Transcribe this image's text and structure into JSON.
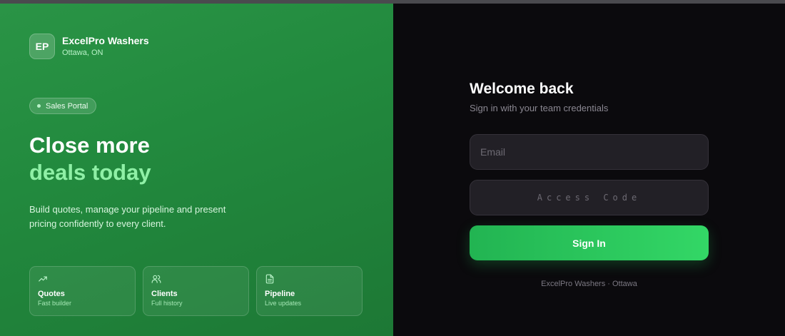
{
  "brand": {
    "logo_initials": "EP",
    "name": "ExcelPro Washers",
    "location": "Ottawa, ON"
  },
  "badge": {
    "label": "Sales Portal"
  },
  "hero": {
    "headline_line1": "Close more",
    "headline_line2": "deals today",
    "description": "Build quotes, manage your pipeline and present pricing confidently to every client."
  },
  "features": [
    {
      "icon": "trending-up-icon",
      "title": "Quotes",
      "subtitle": "Fast builder"
    },
    {
      "icon": "users-icon",
      "title": "Clients",
      "subtitle": "Full history"
    },
    {
      "icon": "file-text-icon",
      "title": "Pipeline",
      "subtitle": "Live updates"
    }
  ],
  "login": {
    "title": "Welcome back",
    "subtitle": "Sign in with your team credentials",
    "email_placeholder": "Email",
    "email_value": "",
    "code_placeholder": "Access Code",
    "code_value": "",
    "submit_label": "Sign In",
    "footer": "ExcelPro Washers · Ottawa"
  },
  "colors": {
    "brand_green": "#228a3e",
    "accent_green": "#8ff0a6",
    "button_green": "#33d766",
    "panel_dark": "#0b0a0d",
    "input_bg": "#222026"
  }
}
